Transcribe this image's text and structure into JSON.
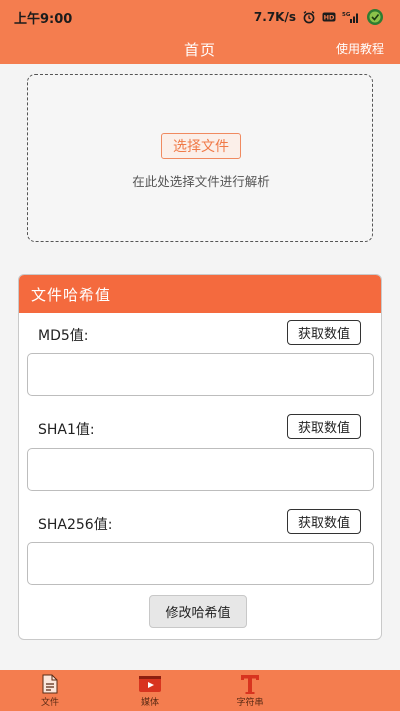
{
  "status_bar": {
    "time": "上午9:00",
    "net_speed": "7.7K/s",
    "icons": [
      "alarm-icon",
      "hd-icon",
      "signal-5g-icon",
      "app-status-icon"
    ]
  },
  "app_bar": {
    "title": "首页",
    "tutorial": "使用教程"
  },
  "picker": {
    "button": "选择文件",
    "hint": "在此处选择文件进行解析"
  },
  "hash_card": {
    "title": "文件哈希值",
    "rows": [
      {
        "label": "MD5值:",
        "button": "获取数值",
        "value": ""
      },
      {
        "label": "SHA1值:",
        "button": "获取数值",
        "value": ""
      },
      {
        "label": "SHA256值:",
        "button": "获取数值",
        "value": ""
      }
    ],
    "modify_button": "修改哈希值"
  },
  "bottom_nav": {
    "items": [
      {
        "label": "文件",
        "icon": "file-icon"
      },
      {
        "label": "媒体",
        "icon": "media-play-icon"
      },
      {
        "label": "字符串",
        "icon": "text-t-icon"
      },
      {
        "label": "",
        "icon": ""
      }
    ]
  },
  "colors": {
    "accent": "#f47d4f",
    "card_header": "#f46a3e",
    "button_outline": "#f08a60"
  }
}
